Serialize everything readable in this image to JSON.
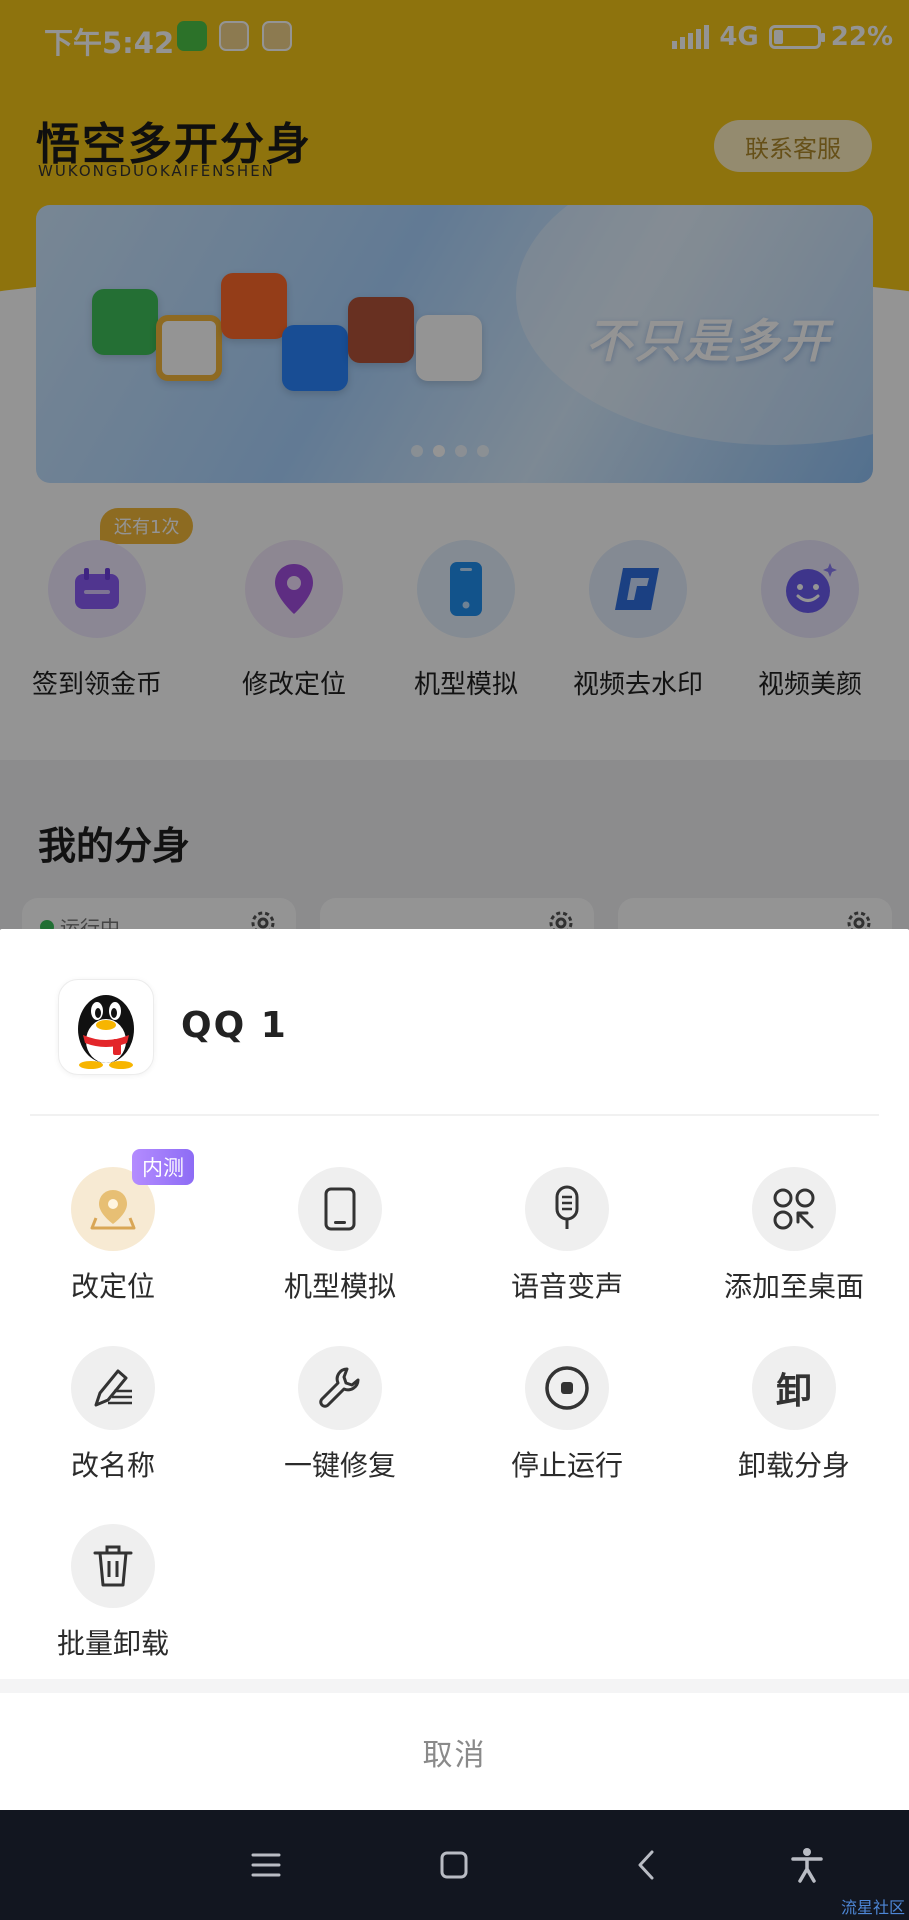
{
  "status_bar": {
    "time": "下午5:42",
    "network": "4G",
    "battery": "22%",
    "battery_level": 0.22
  },
  "header": {
    "brand_title": "悟空多开分身",
    "brand_subtitle": "WUKONGDUOKAIFENSHEN",
    "customer_service": "联系客服"
  },
  "banner": {
    "slogan": "不只是多开",
    "icons": [
      "wechat-icon",
      "weibo-icon",
      "taobao-icon",
      "dingtalk-icon",
      "game-icon",
      "tencent-video-icon"
    ],
    "page_count": 4,
    "active_page": 1
  },
  "features": {
    "badge": "还有1次",
    "items": [
      {
        "label": "签到领金币",
        "icon": "calendar-icon",
        "color": "#8b5cf6"
      },
      {
        "label": "修改定位",
        "icon": "location-pin-icon",
        "color": "#9b3fd8"
      },
      {
        "label": "机型模拟",
        "icon": "phone-icon",
        "color": "#1f8ff0"
      },
      {
        "label": "视频去水印",
        "icon": "watermark-remove-icon",
        "color": "#2f6fe0"
      },
      {
        "label": "视频美颜",
        "icon": "smile-icon",
        "color": "#6b5cf0"
      }
    ]
  },
  "my_clones": {
    "title": "我的分身",
    "first_status": "运行中"
  },
  "sheet": {
    "app_name": "QQ 1",
    "beta_badge": "内测",
    "actions": [
      {
        "label": "改定位",
        "icon": "location-map-icon"
      },
      {
        "label": "机型模拟",
        "icon": "phone-icon"
      },
      {
        "label": "语音变声",
        "icon": "microphone-icon"
      },
      {
        "label": "添加至桌面",
        "icon": "add-to-desktop-icon"
      },
      {
        "label": "改名称",
        "icon": "rename-pen-icon"
      },
      {
        "label": "一键修复",
        "icon": "wrench-icon"
      },
      {
        "label": "停止运行",
        "icon": "stop-icon"
      },
      {
        "label": "卸载分身",
        "icon": "uninstall-icon"
      },
      {
        "label": "批量卸载",
        "icon": "trash-icon"
      }
    ],
    "uninstall_glyph": "卸",
    "cancel": "取消"
  },
  "nav_bar": {
    "buttons": [
      "menu-icon",
      "home-icon",
      "back-icon",
      "accessibility-icon"
    ]
  },
  "watermark": "流星社区"
}
